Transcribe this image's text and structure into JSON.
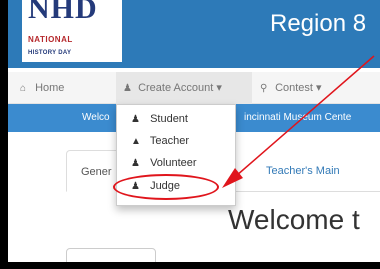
{
  "header": {
    "logo": {
      "main": "NHD",
      "line2": "NATIONAL",
      "line3": "HISTORY DAY"
    },
    "region_title": "Region 8",
    "colors": {
      "banner": "#2d7ab8",
      "logo_blue": "#243a7a",
      "logo_red": "#b6282c"
    }
  },
  "navbar": {
    "home": {
      "icon": "home-icon",
      "label": "Home"
    },
    "create_account": {
      "icon": "users-icon",
      "label": "Create Account",
      "caret": "▾"
    },
    "contest": {
      "icon": "map-marker-icon",
      "label": "Contest",
      "caret": "▾"
    }
  },
  "infobar": {
    "left_text": "Welco",
    "right_text": "incinnati Museum Cente",
    "color": "#3b8bcf"
  },
  "dropdown": {
    "items": [
      {
        "icon": "users-icon",
        "label": "Student"
      },
      {
        "icon": "graduation-cap-icon",
        "label": "Teacher"
      },
      {
        "icon": "users-icon",
        "label": "Volunteer"
      },
      {
        "icon": "users-icon",
        "label": "Judge"
      }
    ]
  },
  "tabs": {
    "general": "Gener",
    "teacher_main": "Teacher's Main"
  },
  "main": {
    "welcome": "Welcome t"
  },
  "annotation": {
    "color": "#e0151c"
  }
}
